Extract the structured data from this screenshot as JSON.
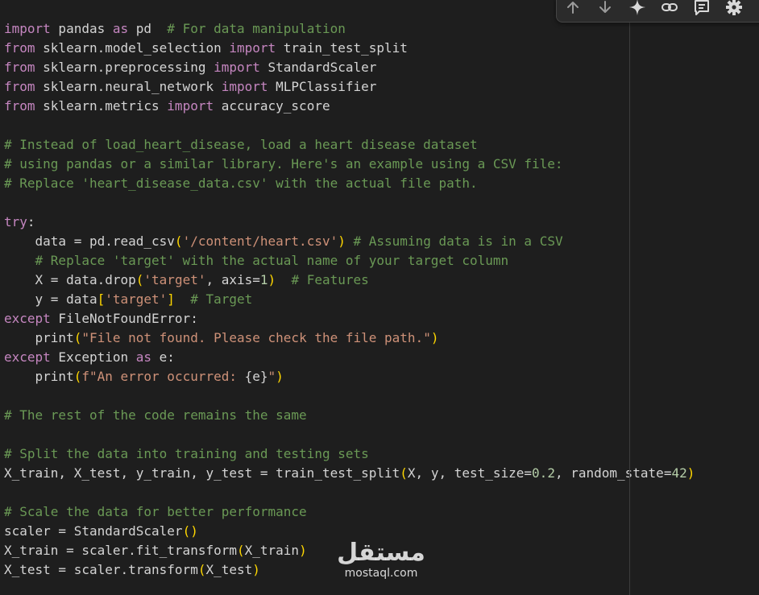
{
  "toolbar": {
    "buttons": [
      {
        "name": "move-up",
        "icon": "arrow-up-icon"
      },
      {
        "name": "move-down",
        "icon": "arrow-down-icon"
      },
      {
        "name": "ai-sparkle",
        "icon": "sparkle-icon"
      },
      {
        "name": "copy-link",
        "icon": "link-icon"
      },
      {
        "name": "comment",
        "icon": "comment-icon"
      },
      {
        "name": "settings",
        "icon": "gear-icon"
      }
    ]
  },
  "code_lines": [
    [
      [
        "kw",
        "import"
      ],
      [
        "pl",
        " pandas "
      ],
      [
        "kw",
        "as"
      ],
      [
        "pl",
        " pd  "
      ],
      [
        "cm",
        "# For data manipulation"
      ]
    ],
    [
      [
        "kw",
        "from"
      ],
      [
        "pl",
        " sklearn.model_selection "
      ],
      [
        "kw",
        "import"
      ],
      [
        "pl",
        " train_test_split"
      ]
    ],
    [
      [
        "kw",
        "from"
      ],
      [
        "pl",
        " sklearn.preprocessing "
      ],
      [
        "kw",
        "import"
      ],
      [
        "pl",
        " StandardScaler"
      ]
    ],
    [
      [
        "kw",
        "from"
      ],
      [
        "pl",
        " sklearn.neural_network "
      ],
      [
        "kw",
        "import"
      ],
      [
        "pl",
        " MLPClassifier"
      ]
    ],
    [
      [
        "kw",
        "from"
      ],
      [
        "pl",
        " sklearn.metrics "
      ],
      [
        "kw",
        "import"
      ],
      [
        "pl",
        " accuracy_score"
      ]
    ],
    [],
    [
      [
        "cm",
        "# Instead of load_heart_disease, load a heart disease dataset"
      ]
    ],
    [
      [
        "cm",
        "# using pandas or a similar library. Here's an example using a CSV file:"
      ]
    ],
    [
      [
        "cm",
        "# Replace 'heart_disease_data.csv' with the actual file path."
      ]
    ],
    [],
    [
      [
        "kw",
        "try"
      ],
      [
        "pl",
        ":"
      ]
    ],
    [
      [
        "pl",
        "    data = pd.read_csv"
      ],
      [
        "br",
        "("
      ],
      [
        "st",
        "'/content/heart.csv'"
      ],
      [
        "br",
        ")"
      ],
      [
        "pl",
        " "
      ],
      [
        "cm",
        "# Assuming data is in a CSV"
      ]
    ],
    [
      [
        "pl",
        "    "
      ],
      [
        "cm",
        "# Replace 'target' with the actual name of your target column"
      ]
    ],
    [
      [
        "pl",
        "    X = data.drop"
      ],
      [
        "br",
        "("
      ],
      [
        "st",
        "'target'"
      ],
      [
        "pl",
        ", axis="
      ],
      [
        "nm",
        "1"
      ],
      [
        "br",
        ")"
      ],
      [
        "pl",
        "  "
      ],
      [
        "cm",
        "# Features"
      ]
    ],
    [
      [
        "pl",
        "    y = data"
      ],
      [
        "br",
        "["
      ],
      [
        "st",
        "'target'"
      ],
      [
        "br",
        "]"
      ],
      [
        "pl",
        "  "
      ],
      [
        "cm",
        "# Target"
      ]
    ],
    [
      [
        "kw",
        "except"
      ],
      [
        "pl",
        " FileNotFoundError:"
      ]
    ],
    [
      [
        "pl",
        "    print"
      ],
      [
        "br",
        "("
      ],
      [
        "st",
        "\"File not found. Please check the file path.\""
      ],
      [
        "br",
        ")"
      ]
    ],
    [
      [
        "kw",
        "except"
      ],
      [
        "pl",
        " Exception "
      ],
      [
        "kw",
        "as"
      ],
      [
        "pl",
        " e:"
      ]
    ],
    [
      [
        "pl",
        "    print"
      ],
      [
        "br",
        "("
      ],
      [
        "st",
        "f\"An error occurred: "
      ],
      [
        "pl",
        "{e}"
      ],
      [
        "st",
        "\""
      ],
      [
        "br",
        ")"
      ]
    ],
    [],
    [
      [
        "cm",
        "# The rest of the code remains the same"
      ]
    ],
    [],
    [
      [
        "cm",
        "# Split the data into training and testing sets"
      ]
    ],
    [
      [
        "pl",
        "X_train, X_test, y_train, y_test = train_test_split"
      ],
      [
        "br",
        "("
      ],
      [
        "pl",
        "X, y, test_size="
      ],
      [
        "nm",
        "0.2"
      ],
      [
        "pl",
        ", random_state="
      ],
      [
        "nm",
        "42"
      ],
      [
        "br",
        ")"
      ]
    ],
    [],
    [
      [
        "cm",
        "# Scale the data for better performance"
      ]
    ],
    [
      [
        "pl",
        "scaler = StandardScaler"
      ],
      [
        "br",
        "()"
      ]
    ],
    [
      [
        "pl",
        "X_train = scaler.fit_transform"
      ],
      [
        "br",
        "("
      ],
      [
        "pl",
        "X_train"
      ],
      [
        "br",
        ")"
      ]
    ],
    [
      [
        "pl",
        "X_test = scaler.transform"
      ],
      [
        "br",
        "("
      ],
      [
        "pl",
        "X_test"
      ],
      [
        "br",
        ")"
      ]
    ]
  ],
  "watermark": {
    "logo_text": "مستقل",
    "domain": "mostaql.com"
  }
}
